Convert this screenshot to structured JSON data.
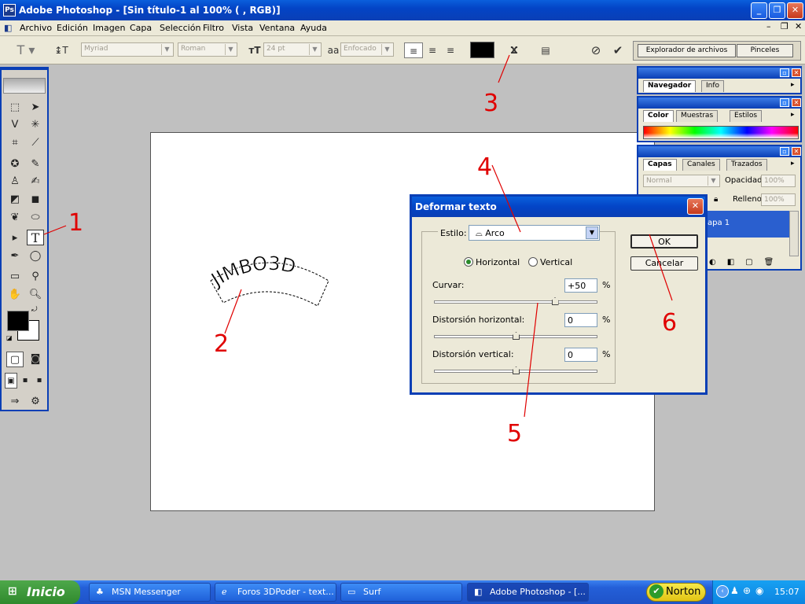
{
  "window": {
    "title": "Adobe Photoshop - [Sin título-1 al 100% ( , RGB)]",
    "app_icon": "photoshop-icon"
  },
  "menu": [
    "Archivo",
    "Edición",
    "Imagen",
    "Capa",
    "Selección",
    "Filtro",
    "Vista",
    "Ventana",
    "Ayuda"
  ],
  "options": {
    "font_family": "Myriad",
    "font_style": "Roman",
    "font_size": "24 pt",
    "aa_label": "a",
    "antialias": "Enfocado",
    "file_browser": "Explorador de archivos",
    "brushes": "Pinceles",
    "text_color": "#000000"
  },
  "canvas": {
    "warped_text": "JIMBO3D"
  },
  "palettes": {
    "navigator": {
      "tabs": [
        "Navegador",
        "Info"
      ]
    },
    "color": {
      "tabs": [
        "Color",
        "Muestras",
        "Estilos"
      ]
    },
    "layers": {
      "tabs": [
        "Capas",
        "Canales",
        "Trazados"
      ],
      "blend_mode": "Normal",
      "opacity_label": "Opacidad:",
      "opacity": "100%",
      "fill_label": "Relleno:",
      "fill": "100%",
      "layer_name": "Capa 1",
      "layer_name_visible": "apa 1"
    }
  },
  "dialog": {
    "title": "Deformar texto",
    "style_label": "Estilo:",
    "style_value": "Arco",
    "orientation": {
      "horizontal": "Horizontal",
      "vertical": "Vertical",
      "selected": "horizontal"
    },
    "sliders": [
      {
        "label": "Curvar:",
        "value": "+50",
        "unit": "%",
        "level": 50
      },
      {
        "label": "Distorsión horizontal:",
        "value": "0",
        "unit": "%",
        "level": 0
      },
      {
        "label": "Distorsión vertical:",
        "value": "0",
        "unit": "%",
        "level": 0
      }
    ],
    "ok": "OK",
    "cancel": "Cancelar"
  },
  "annotations": [
    "1",
    "2",
    "3",
    "4",
    "5",
    "6"
  ],
  "annotation_color": "#e00000",
  "taskbar": {
    "start": "Inicio",
    "tasks": [
      "MSN Messenger",
      "Foros 3DPoder - text...",
      "Surf",
      "Adobe Photoshop - [..."
    ],
    "norton": "Norton",
    "clock": "15:07"
  }
}
